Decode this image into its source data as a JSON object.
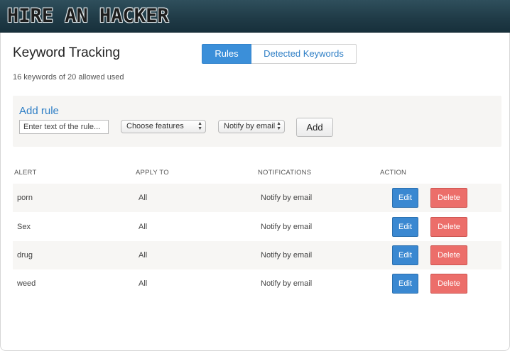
{
  "header": {
    "logo_text": "HIRE AN HACKER"
  },
  "page": {
    "title": "Keyword Tracking",
    "usage_text": "16 keywords of 20 allowed used"
  },
  "tabs": [
    {
      "label": "Rules",
      "active": true
    },
    {
      "label": "Detected Keywords",
      "active": false
    }
  ],
  "add_rule": {
    "title": "Add rule",
    "input_placeholder": "Enter text of the rule...",
    "features_select": "Choose features",
    "notify_select": "Notify by email",
    "add_label": "Add"
  },
  "table": {
    "headers": {
      "alert": "ALERT",
      "apply_to": "APPLY TO",
      "notifications": "NOTIFICATIONS",
      "action": "ACTION"
    },
    "rows": [
      {
        "alert": "porn",
        "apply_to": "All",
        "notifications": "Notify by email",
        "edit": "Edit",
        "delete": "Delete"
      },
      {
        "alert": "Sex",
        "apply_to": "All",
        "notifications": "Notify by email",
        "edit": "Edit",
        "delete": "Delete"
      },
      {
        "alert": "drug",
        "apply_to": "All",
        "notifications": "Notify by email",
        "edit": "Edit",
        "delete": "Delete"
      },
      {
        "alert": "weed",
        "apply_to": "All",
        "notifications": "Notify by email",
        "edit": "Edit",
        "delete": "Delete"
      }
    ]
  },
  "colors": {
    "accent": "#3b8fd9",
    "delete": "#ec6e6a",
    "header_bar": "#1f3a46"
  }
}
